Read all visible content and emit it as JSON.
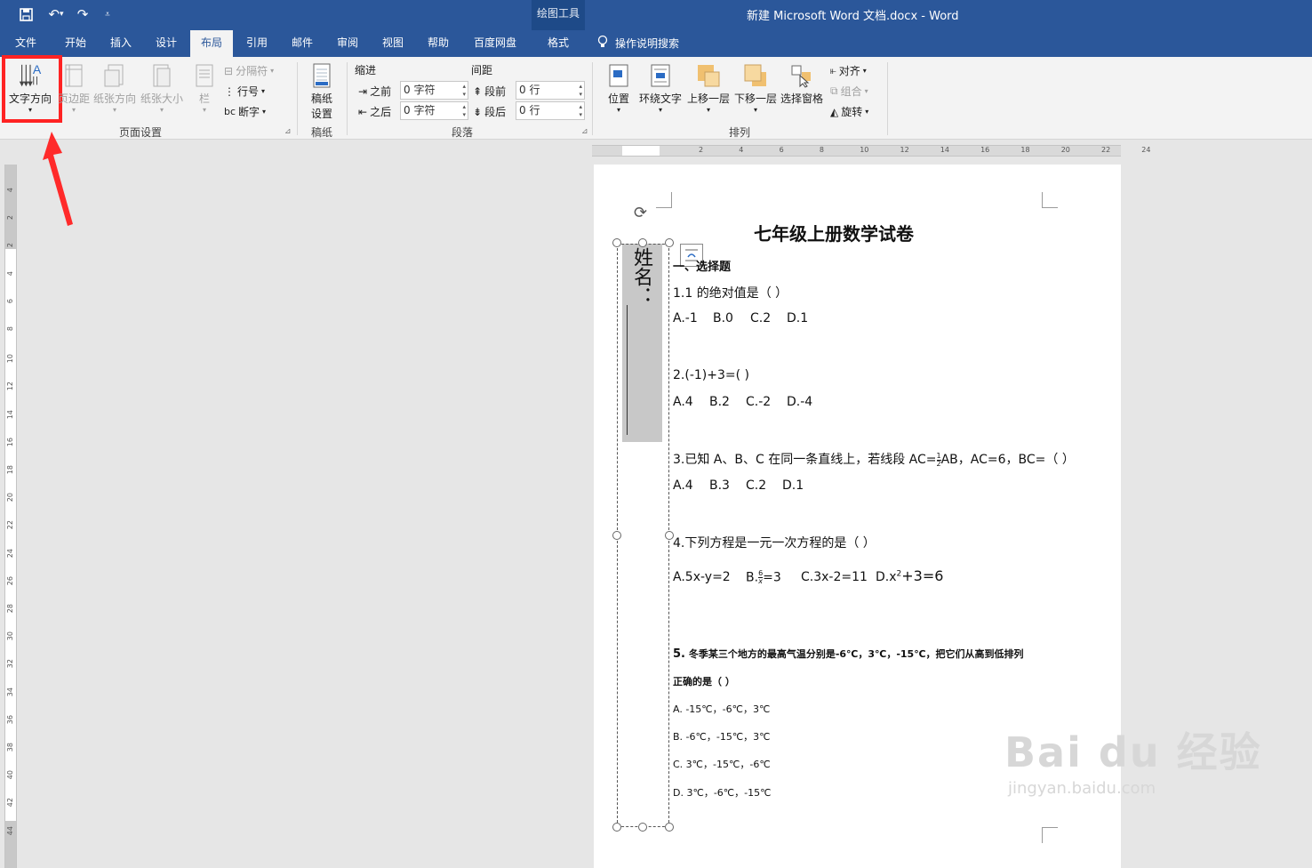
{
  "window": {
    "title": "新建 Microsoft Word 文档.docx  -  Word",
    "context_group": "绘图工具"
  },
  "tabs": [
    {
      "label": "文件"
    },
    {
      "label": "开始"
    },
    {
      "label": "插入"
    },
    {
      "label": "设计"
    },
    {
      "label": "布局"
    },
    {
      "label": "引用"
    },
    {
      "label": "邮件"
    },
    {
      "label": "审阅"
    },
    {
      "label": "视图"
    },
    {
      "label": "帮助"
    },
    {
      "label": "百度网盘"
    },
    {
      "label": "格式"
    }
  ],
  "tell_me": "操作说明搜索",
  "ribbon": {
    "page_setup": {
      "label": "页面设置",
      "text_direction": "文字方向",
      "margins": "页边距",
      "orientation": "纸张方向",
      "size": "纸张大小",
      "columns": "栏",
      "breaks": "分隔符",
      "line_numbers": "行号",
      "hyphenation": "断字"
    },
    "manuscript": {
      "label": "稿纸",
      "settings_line1": "稿纸",
      "settings_line2": "设置"
    },
    "paragraph": {
      "label": "段落",
      "indent": "缩进",
      "spacing": "间距",
      "before": "之前",
      "after": "之后",
      "indent_before_value": "0 字符",
      "indent_after_value": "0 字符",
      "space_before": "段前",
      "space_after": "段后",
      "space_before_value": "0 行",
      "space_after_value": "0 行"
    },
    "arrange": {
      "label": "排列",
      "position": "位置",
      "wrap_text": "环绕文字",
      "bring_forward": "上移一层",
      "send_backward": "下移一层",
      "selection_pane": "选择窗格",
      "align": "对齐",
      "group": "组合",
      "rotate": "旋转"
    }
  },
  "ruler": {
    "h_ticks": [
      "2",
      "4",
      "6",
      "8",
      "10",
      "12",
      "14",
      "16",
      "18",
      "20",
      "22",
      "24"
    ],
    "v_ticks": [
      "4",
      "2",
      "2",
      "4",
      "6",
      "8",
      "10",
      "12",
      "14",
      "16",
      "18",
      "20",
      "22",
      "24",
      "26",
      "28",
      "30",
      "32",
      "34",
      "36",
      "38",
      "40",
      "42",
      "44"
    ]
  },
  "textbox": {
    "content": "姓名："
  },
  "document": {
    "title": "七年级上册数学试卷",
    "section": "一、选择题",
    "q1": "1.1 的绝对值是（   ）",
    "q1_options": [
      "A.-1",
      "B.0",
      "C.2",
      "D.1"
    ],
    "q2": "2.(-1)+3=(    )",
    "q2_options": [
      "A.4",
      "B.2",
      "C.-2",
      "D.-4"
    ],
    "q3_pre": "3.已知 A、B、C 在同一条直线上，若线段 AC=",
    "q3_frac_num": "1",
    "q3_frac_den": "2",
    "q3_post": "AB，AC=6，BC=（     ）",
    "q3_options": [
      "A.4",
      "B.3",
      "C.2",
      "D.1"
    ],
    "q4": "4.下列方程是一元一次方程的是（     ）",
    "q4_a": "A.5x-y=2",
    "q4_b_pre": "B.",
    "q4_b_num": "6",
    "q4_b_den": "x",
    "q4_b_post": "=3",
    "q4_c": "C.3x-2=11",
    "q4_d_pre": "D.x",
    "q4_d_sup": "2",
    "q4_d_post": "+3=6",
    "q5_num": "5.",
    "q5_line1": "冬季某三个地方的最高气温分别是-6℃，3℃，-15℃，把它们从高到低排列",
    "q5_line2": "正确的是（     ）",
    "q5_options": [
      "A. -15℃，-6℃，3℃",
      "B. -6℃，-15℃，3℃",
      "C. 3℃，-15℃，-6℃",
      "D. 3℃，-6℃，-15℃"
    ]
  },
  "watermark": {
    "brand": "Bai du 经验",
    "url": "jingyan.baidu.com"
  },
  "colors": {
    "accent": "#2b579a",
    "highlight": "#ff2323"
  }
}
